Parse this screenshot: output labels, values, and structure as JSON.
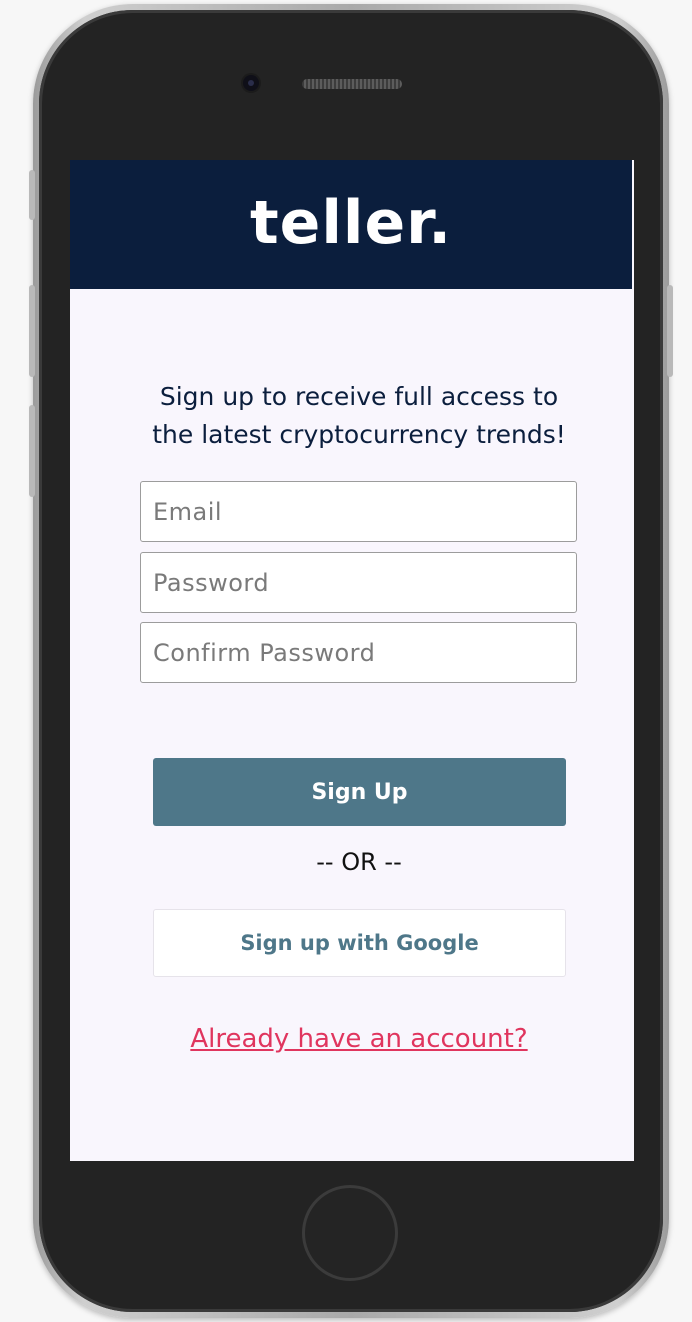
{
  "app": {
    "logo": "teller."
  },
  "signup": {
    "tagline_line1": "Sign up to receive full access to",
    "tagline_line2": "the latest cryptocurrency trends!",
    "email_placeholder": "Email",
    "password_placeholder": "Password",
    "confirm_password_placeholder": "Confirm Password",
    "email_value": "",
    "password_value": "",
    "confirm_password_value": "",
    "submit_label": "Sign Up",
    "divider_text": "-- OR --",
    "google_label": "Sign up with Google",
    "login_link": "Already have an account?"
  },
  "colors": {
    "header_bg": "#0b1e3d",
    "screen_bg": "#f9f6fd",
    "primary_button": "#4e7789",
    "link": "#e0355e"
  }
}
